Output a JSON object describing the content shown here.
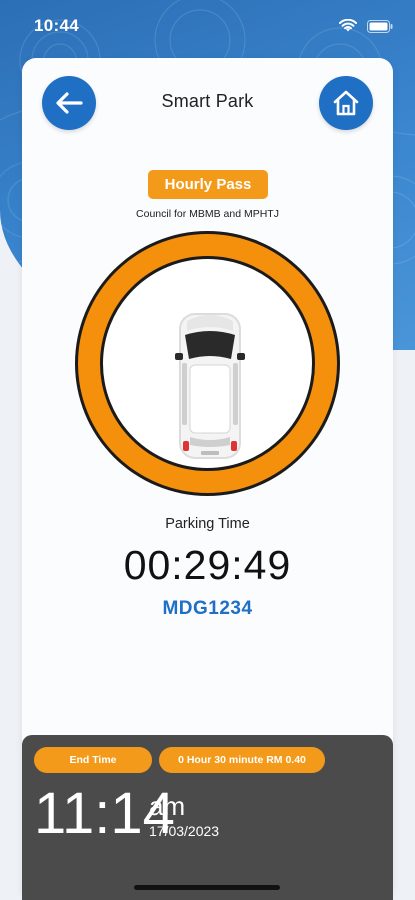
{
  "status_bar": {
    "time": "10:44"
  },
  "header": {
    "title": "Smart Park"
  },
  "pass": {
    "type_label": "Hourly Pass",
    "council": "Council for MBMB and MPHTJ"
  },
  "parking": {
    "label": "Parking Time",
    "elapsed": "00:29:49",
    "plate": "MDG1234"
  },
  "end_panel": {
    "end_label": "End Time",
    "rate_label": "0 Hour 30 minute RM 0.40",
    "time": "11:14",
    "ampm": "am",
    "date": "17/03/2023"
  },
  "colors": {
    "accent_blue": "#1f6fc5",
    "accent_orange": "#f39a1a",
    "panel_gray": "#4b4b4b"
  },
  "icons": {
    "back": "arrow-left-icon",
    "home": "home-icon",
    "car": "car-top-view-icon",
    "wifi": "wifi-icon",
    "battery": "battery-icon"
  }
}
